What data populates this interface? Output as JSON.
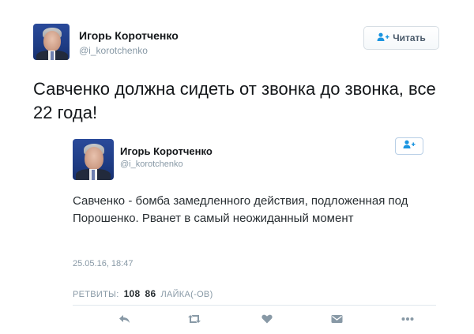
{
  "main_tweet": {
    "author_name": "Игорь Коротченко",
    "author_handle": "@i_korotchenko",
    "follow_label": "Читать",
    "text": "Савченко должна сидеть от звонка до звонка, все 22 года!"
  },
  "quoted_tweet": {
    "author_name": "Игорь Коротченко",
    "author_handle": "@i_korotchenko",
    "text": "Савченко - бомба замедленного действия, подложенная под Порошенко. Рванет в самый неожиданный момент",
    "timestamp": "25.05.16, 18:47",
    "stats": {
      "retweets_label": "РЕТВИТЫ:",
      "retweets_count": "108",
      "likes_count": "86",
      "likes_label": "ЛАЙКА(-ОВ)"
    }
  },
  "colors": {
    "icon_gray": "#8899a6",
    "follow_blue": "#1b95e0"
  },
  "icons": [
    "follow-person-icon",
    "reply-icon",
    "retweet-icon",
    "like-icon",
    "message-icon",
    "more-icon"
  ]
}
